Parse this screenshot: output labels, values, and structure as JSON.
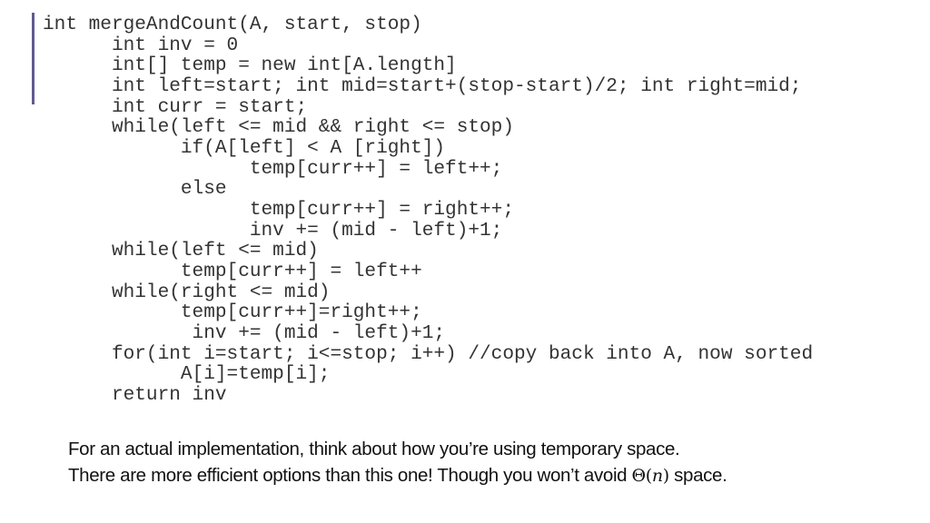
{
  "slide": {
    "accent_color": "#5f5b8f",
    "code": {
      "lines": [
        "int mergeAndCount(A, start, stop)",
        "      int inv = 0",
        "      int[] temp = new int[A.length]",
        "      int left=start; int mid=start+(stop-start)/2; int right=mid;",
        "      int curr = start;",
        "      while(left <= mid && right <= stop)",
        "            if(A[left] < A [right])",
        "                  temp[curr++] = left++;",
        "            else",
        "                  temp[curr++] = right++;",
        "                  inv += (mid - left)+1;",
        "      while(left <= mid)",
        "            temp[curr++] = left++",
        "      while(right <= mid)",
        "            temp[curr++]=right++;",
        "             inv += (mid - left)+1;",
        "      for(int i=start; i<=stop; i++) //copy back into A, now sorted",
        "            A[i]=temp[i];",
        "      return inv"
      ]
    },
    "note": {
      "line1": "For an actual implementation, think about how you’re using temporary space.",
      "line2_before": "There are more efficient options than this one! Though you won’t avoid ",
      "line2_theta": "Θ(",
      "line2_n": "n",
      "line2_close": ")",
      "line2_after": " space."
    }
  }
}
